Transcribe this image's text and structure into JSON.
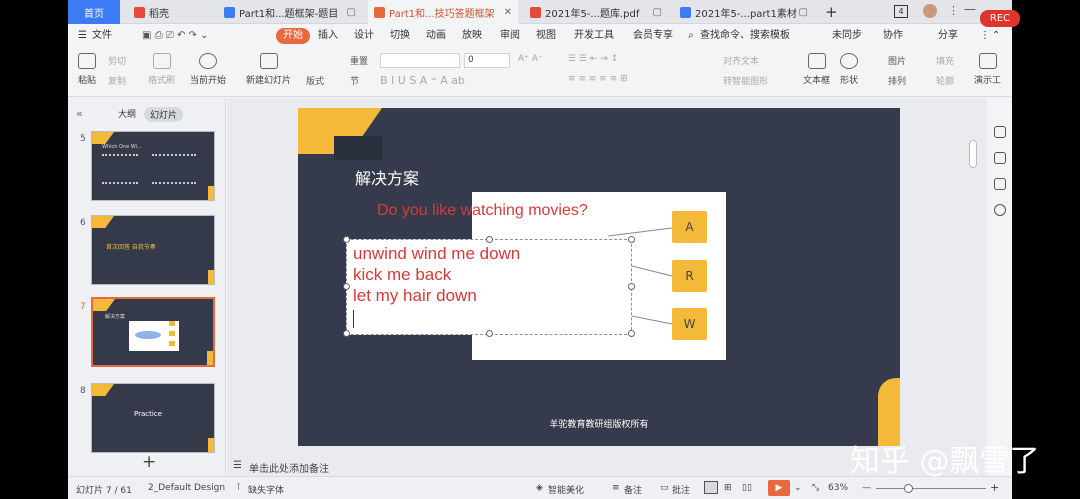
{
  "tabs": [
    {
      "label": "首页"
    },
    {
      "label": "稻壳"
    },
    {
      "label": "Part1和...题框架-题目"
    },
    {
      "label": "Part1和...技巧答题框架"
    },
    {
      "label": "2021年5-...题库.pdf"
    },
    {
      "label": "2021年5-...part1素材"
    }
  ],
  "tabbar": {
    "add": "+",
    "count": "4"
  },
  "rec_label": "REC",
  "menu": {
    "file": "文件",
    "items": [
      "开始",
      "插入",
      "设计",
      "切换",
      "动画",
      "放映",
      "审阅",
      "视图",
      "开发工具",
      "会员专享"
    ],
    "search": "查找命令、搜索模板",
    "right": [
      "未同步",
      "协作",
      "分享"
    ]
  },
  "ribbon": {
    "paste": "粘贴",
    "cut": "剪切",
    "copy": "复制",
    "format": "格式刷",
    "from_current": "当前开始",
    "new_slide": "新建幻灯片",
    "layout": "版式",
    "reset": "重置",
    "section": "节",
    "font_size": "0",
    "align_text": "对齐文本",
    "smartart": "转智能图形",
    "textbox": "文本框",
    "shape": "形状",
    "picture": "图片",
    "arrange": "排列",
    "fill": "填充",
    "outline": "轮廓",
    "present": "演示工"
  },
  "left_pane": {
    "tab_outline": "大纲",
    "tab_slides": "幻灯片",
    "thumbs": [
      {
        "num": "5",
        "caption": "Which One Wi..."
      },
      {
        "num": "6",
        "caption": "首次回答 自我节奏"
      },
      {
        "num": "7",
        "caption": "解决方案"
      },
      {
        "num": "8",
        "caption": "Practice"
      }
    ],
    "add": "+"
  },
  "slide": {
    "title": "解决方案",
    "question": "Do you like watching movies?",
    "lines": [
      "unwind  wind me down",
      "kick me back",
      "let my hair down"
    ],
    "answers": [
      "A",
      "R",
      "W"
    ],
    "footer": "羊驼教育教研组版权所有"
  },
  "notes_placeholder": "单击此处添加备注",
  "status": {
    "slide_index": "幻灯片 7 / 61",
    "theme": "2_Default Design",
    "missing_font": "缺失字体",
    "beautify": "智能美化",
    "notes": "备注",
    "comments": "批注",
    "zoom": "63%"
  },
  "watermark": "知乎 @飘雪了",
  "colors": {
    "accent": "#e8693f",
    "slide_bg": "#353b4c",
    "yellow": "#f5b93a",
    "text_red": "#d63a3a"
  }
}
